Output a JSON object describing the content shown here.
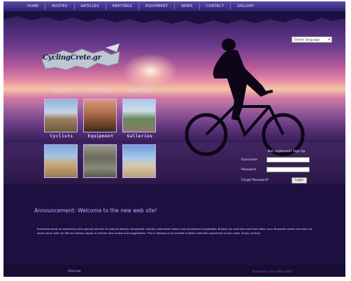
{
  "nav": {
    "items": [
      "Home",
      "Routes",
      "Articles",
      "Meetings",
      "Equipment",
      "News",
      "Contact",
      "Gallery"
    ]
  },
  "header": {
    "language_select": "Select language",
    "logo_text": "CyclingCrete.gr"
  },
  "sections": {
    "top_labels": [
      "Routes",
      "Articles",
      "Meetings"
    ],
    "bottom_labels": [
      "Cyclists",
      "Equipment",
      "Galleries"
    ]
  },
  "login": {
    "register_text": "Not registered? Sign Up",
    "username_label": "Username",
    "password_label": "Password",
    "forgot_label": "Forgot Password?",
    "login_button": "Login"
  },
  "announcement": {
    "title": "Announcement: Welcome to the new web site!",
    "body": "Everyone wants to experience this special land for its natural beauty, temperate climate, influential history and exceptional hospitality. Browse our web site and track down your favourite routes and why not share yours with us! We are always happy to receive new routes and suggestions. This is helping us to provide a better web site experience to our users. Enjoy cycling!"
  },
  "footer": {
    "sitemap": "Sitemap",
    "credit": "Powered by Xena Web 2009"
  },
  "colors": {
    "background": "#1d1040",
    "nav": "#3a2c86",
    "accent": "#c9a6ff"
  }
}
